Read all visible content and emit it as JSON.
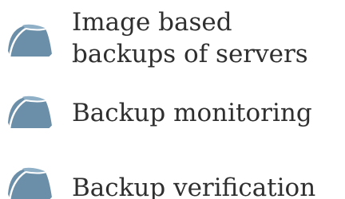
{
  "list": {
    "items": [
      {
        "label": "Image based backups of servers",
        "icon": "hard-drive-icon"
      },
      {
        "label": "Backup monitoring",
        "icon": "hard-drive-icon"
      },
      {
        "label": "Backup verification",
        "icon": "hard-drive-icon"
      }
    ]
  },
  "colors": {
    "icon_fill": "#6b8fa8",
    "icon_highlight": "#8fb0c6",
    "icon_outline": "#ffffff",
    "text": "#2f2f2f"
  }
}
